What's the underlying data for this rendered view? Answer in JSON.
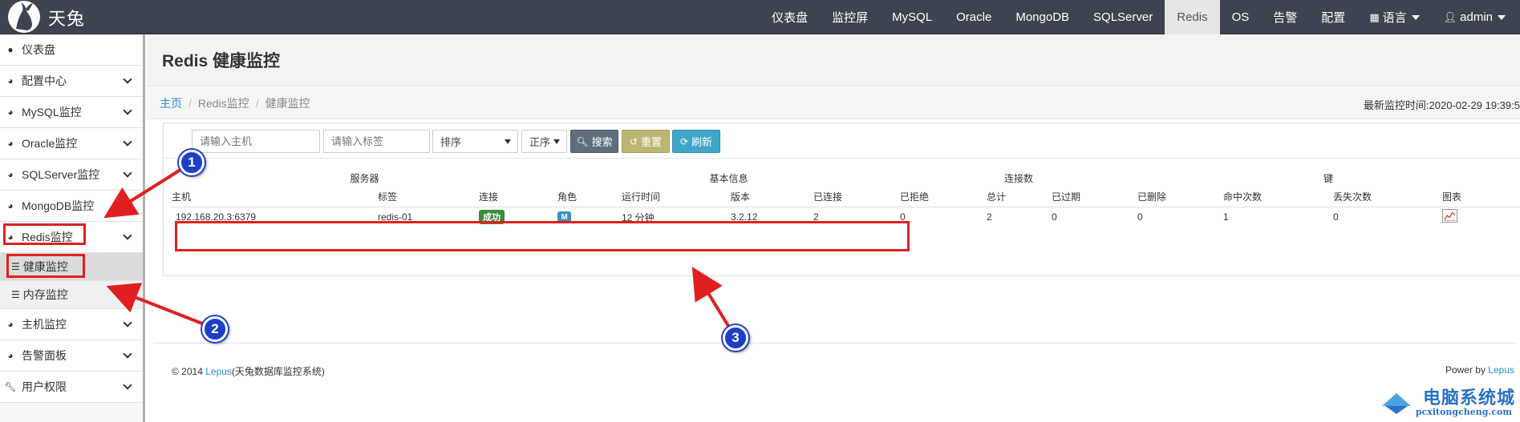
{
  "brand": {
    "title": "天兔"
  },
  "topnav": {
    "items": [
      "仪表盘",
      "监控屏",
      "MySQL",
      "Oracle",
      "MongoDB",
      "SQLServer",
      "Redis",
      "OS",
      "告警",
      "配置"
    ],
    "active": "Redis",
    "language": "语言",
    "user": "admin"
  },
  "sidebar": {
    "items": [
      {
        "label": "仪表盘",
        "icon": "comment-icon"
      },
      {
        "label": "配置中心",
        "icon": "dashboard-icon"
      },
      {
        "label": "MySQL监控",
        "icon": "dashboard-icon"
      },
      {
        "label": "Oracle监控",
        "icon": "dashboard-icon"
      },
      {
        "label": "SQLServer监控",
        "icon": "dashboard-icon"
      },
      {
        "label": "MongoDB监控",
        "icon": "dashboard-icon"
      },
      {
        "label": "Redis监控",
        "icon": "dashboard-icon"
      },
      {
        "label": "主机监控",
        "icon": "dashboard-icon"
      },
      {
        "label": "告警面板",
        "icon": "dashboard-icon"
      },
      {
        "label": "用户权限",
        "icon": "wrench-icon"
      }
    ],
    "redis_sub": [
      "健康监控",
      "内存监控"
    ]
  },
  "page": {
    "title": "Redis 健康监控",
    "breadcrumb": [
      "主页",
      "Redis监控",
      "健康监控"
    ],
    "last_monitor": "最新监控时间:2020-02-29 19:39:5"
  },
  "filters": {
    "host_placeholder": "请输入主机",
    "tag_placeholder": "请输入标签",
    "sort_label": "排序",
    "order_label": "正序",
    "search_label": "搜索",
    "reset_label": "重置",
    "refresh_label": "刷新"
  },
  "table": {
    "groups": [
      "服务器",
      "基本信息",
      "连接数",
      "键"
    ],
    "columns": [
      "主机",
      "标签",
      "连接",
      "角色",
      "运行时间",
      "版本",
      "已连接",
      "已拒绝",
      "总计",
      "已过期",
      "已删除",
      "命中次数",
      "丢失次数",
      "图表"
    ],
    "rows": [
      {
        "host": "192.168.20.3:6379",
        "tag": "redis-01",
        "connect": "成功",
        "role": "M",
        "uptime": "12 分钟",
        "version": "3.2.12",
        "connected": "2",
        "rejected": "0",
        "total": "2",
        "expired": "0",
        "deleted": "0",
        "hits": "1",
        "misses": "0"
      }
    ]
  },
  "footer": {
    "copyright": "© 2014 ",
    "lepus": "Lepus",
    "system": "(天兔数据库监控系统)",
    "power": "Power by ",
    "power_link": "Lepus"
  },
  "annotations": {
    "markers": [
      "1",
      "2",
      "3"
    ]
  },
  "watermark": {
    "title": "电脑系统城",
    "url": "pcxitongcheng.com"
  },
  "colors": {
    "navbar": "#3d4350",
    "annotation_red": "#e02020",
    "marker_blue": "#1e3ec8",
    "link": "#2a8dcc"
  }
}
